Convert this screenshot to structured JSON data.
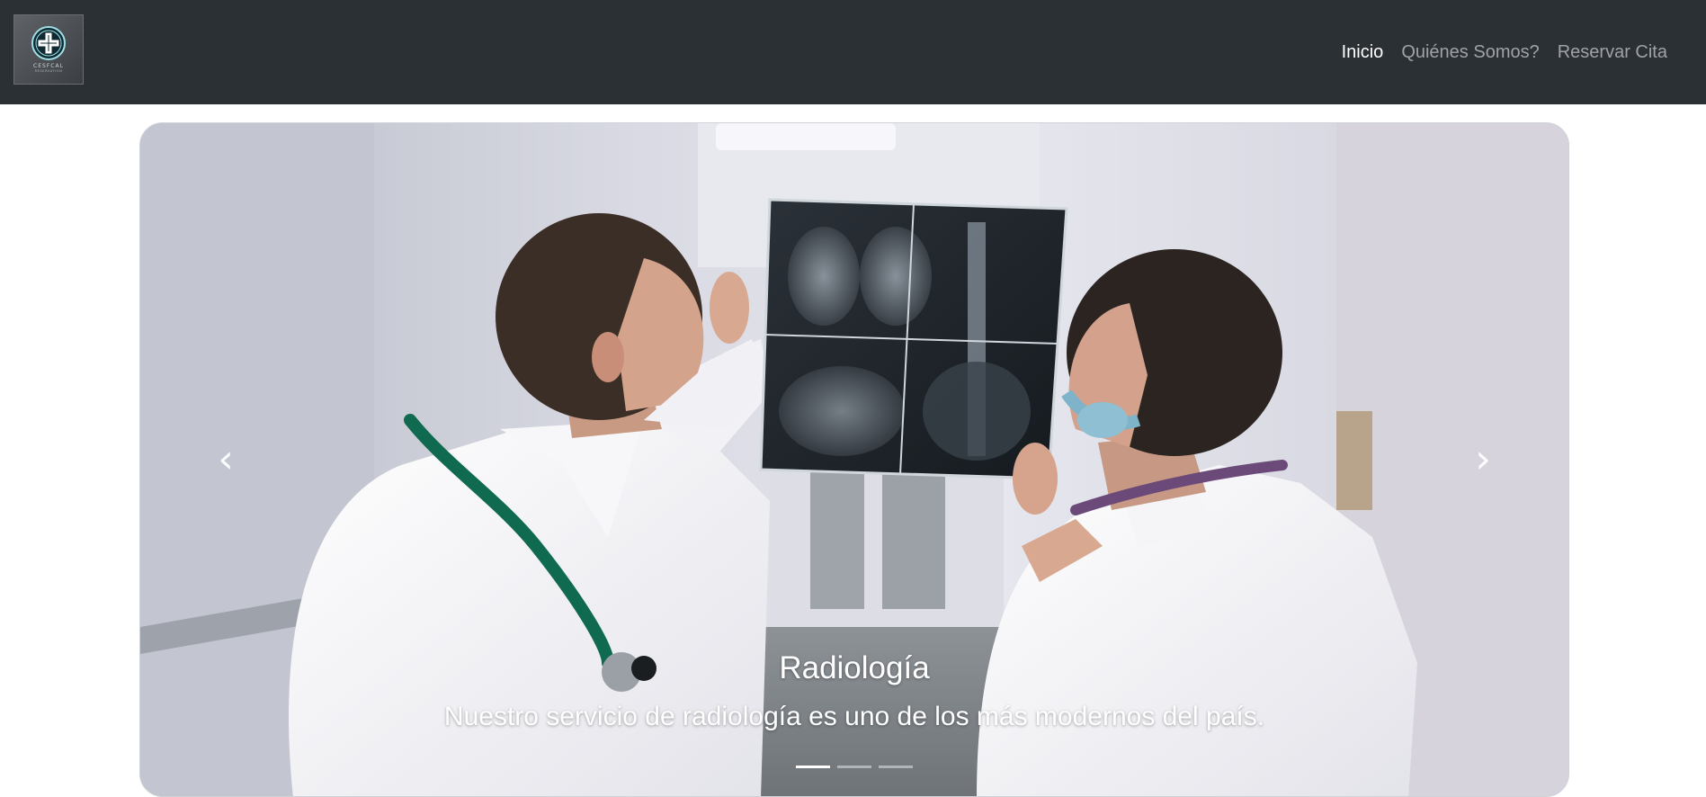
{
  "brand": {
    "logo_text": "CESFCAL",
    "logo_subtext": "RESERVATION"
  },
  "nav": {
    "items": [
      {
        "label": "Inicio",
        "active": true
      },
      {
        "label": "Quiénes Somos?",
        "active": false
      },
      {
        "label": "Reservar Cita",
        "active": false
      }
    ]
  },
  "carousel": {
    "prev_icon": "chevron-left-icon",
    "next_icon": "chevron-right-icon",
    "slide": {
      "title": "Radiología",
      "text": "Nuestro servicio de radiología es uno de los más modernos del país."
    },
    "indicators": [
      {
        "active": true
      },
      {
        "active": false
      },
      {
        "active": false
      }
    ]
  },
  "colors": {
    "navbar_bg": "#2b3035",
    "nav_active": "#ffffff",
    "nav_inactive": "rgba(255,255,255,0.55)"
  }
}
